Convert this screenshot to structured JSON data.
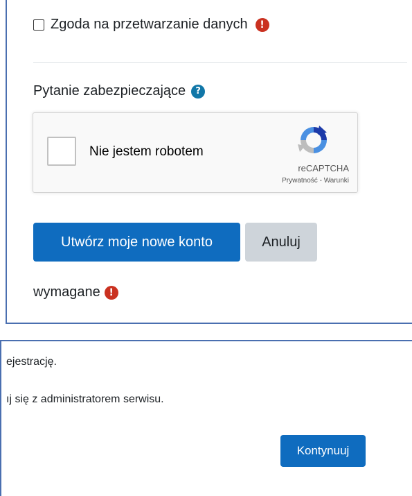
{
  "form": {
    "consent_label": "Zgoda na przetwarzanie danych",
    "required_glyph": "!",
    "security_question_label": "Pytanie zabezpieczające",
    "help_glyph": "?",
    "captcha": {
      "label": "Nie jestem robotem",
      "brand": "reCAPTCHA",
      "links": "Prywatność - Warunki"
    },
    "submit_label": "Utwórz moje nowe konto",
    "cancel_label": "Anuluj",
    "required_label": "wymagane"
  },
  "confirmation": {
    "message_line1": "ejestrację.",
    "message_line2": "ıj się z administratorem serwisu.",
    "continue_label": "Kontynuuj"
  },
  "colors": {
    "primary": "#0f6cbf",
    "danger": "#ca3120",
    "info": "#1177a8",
    "frame_border": "#4a6fb0"
  }
}
